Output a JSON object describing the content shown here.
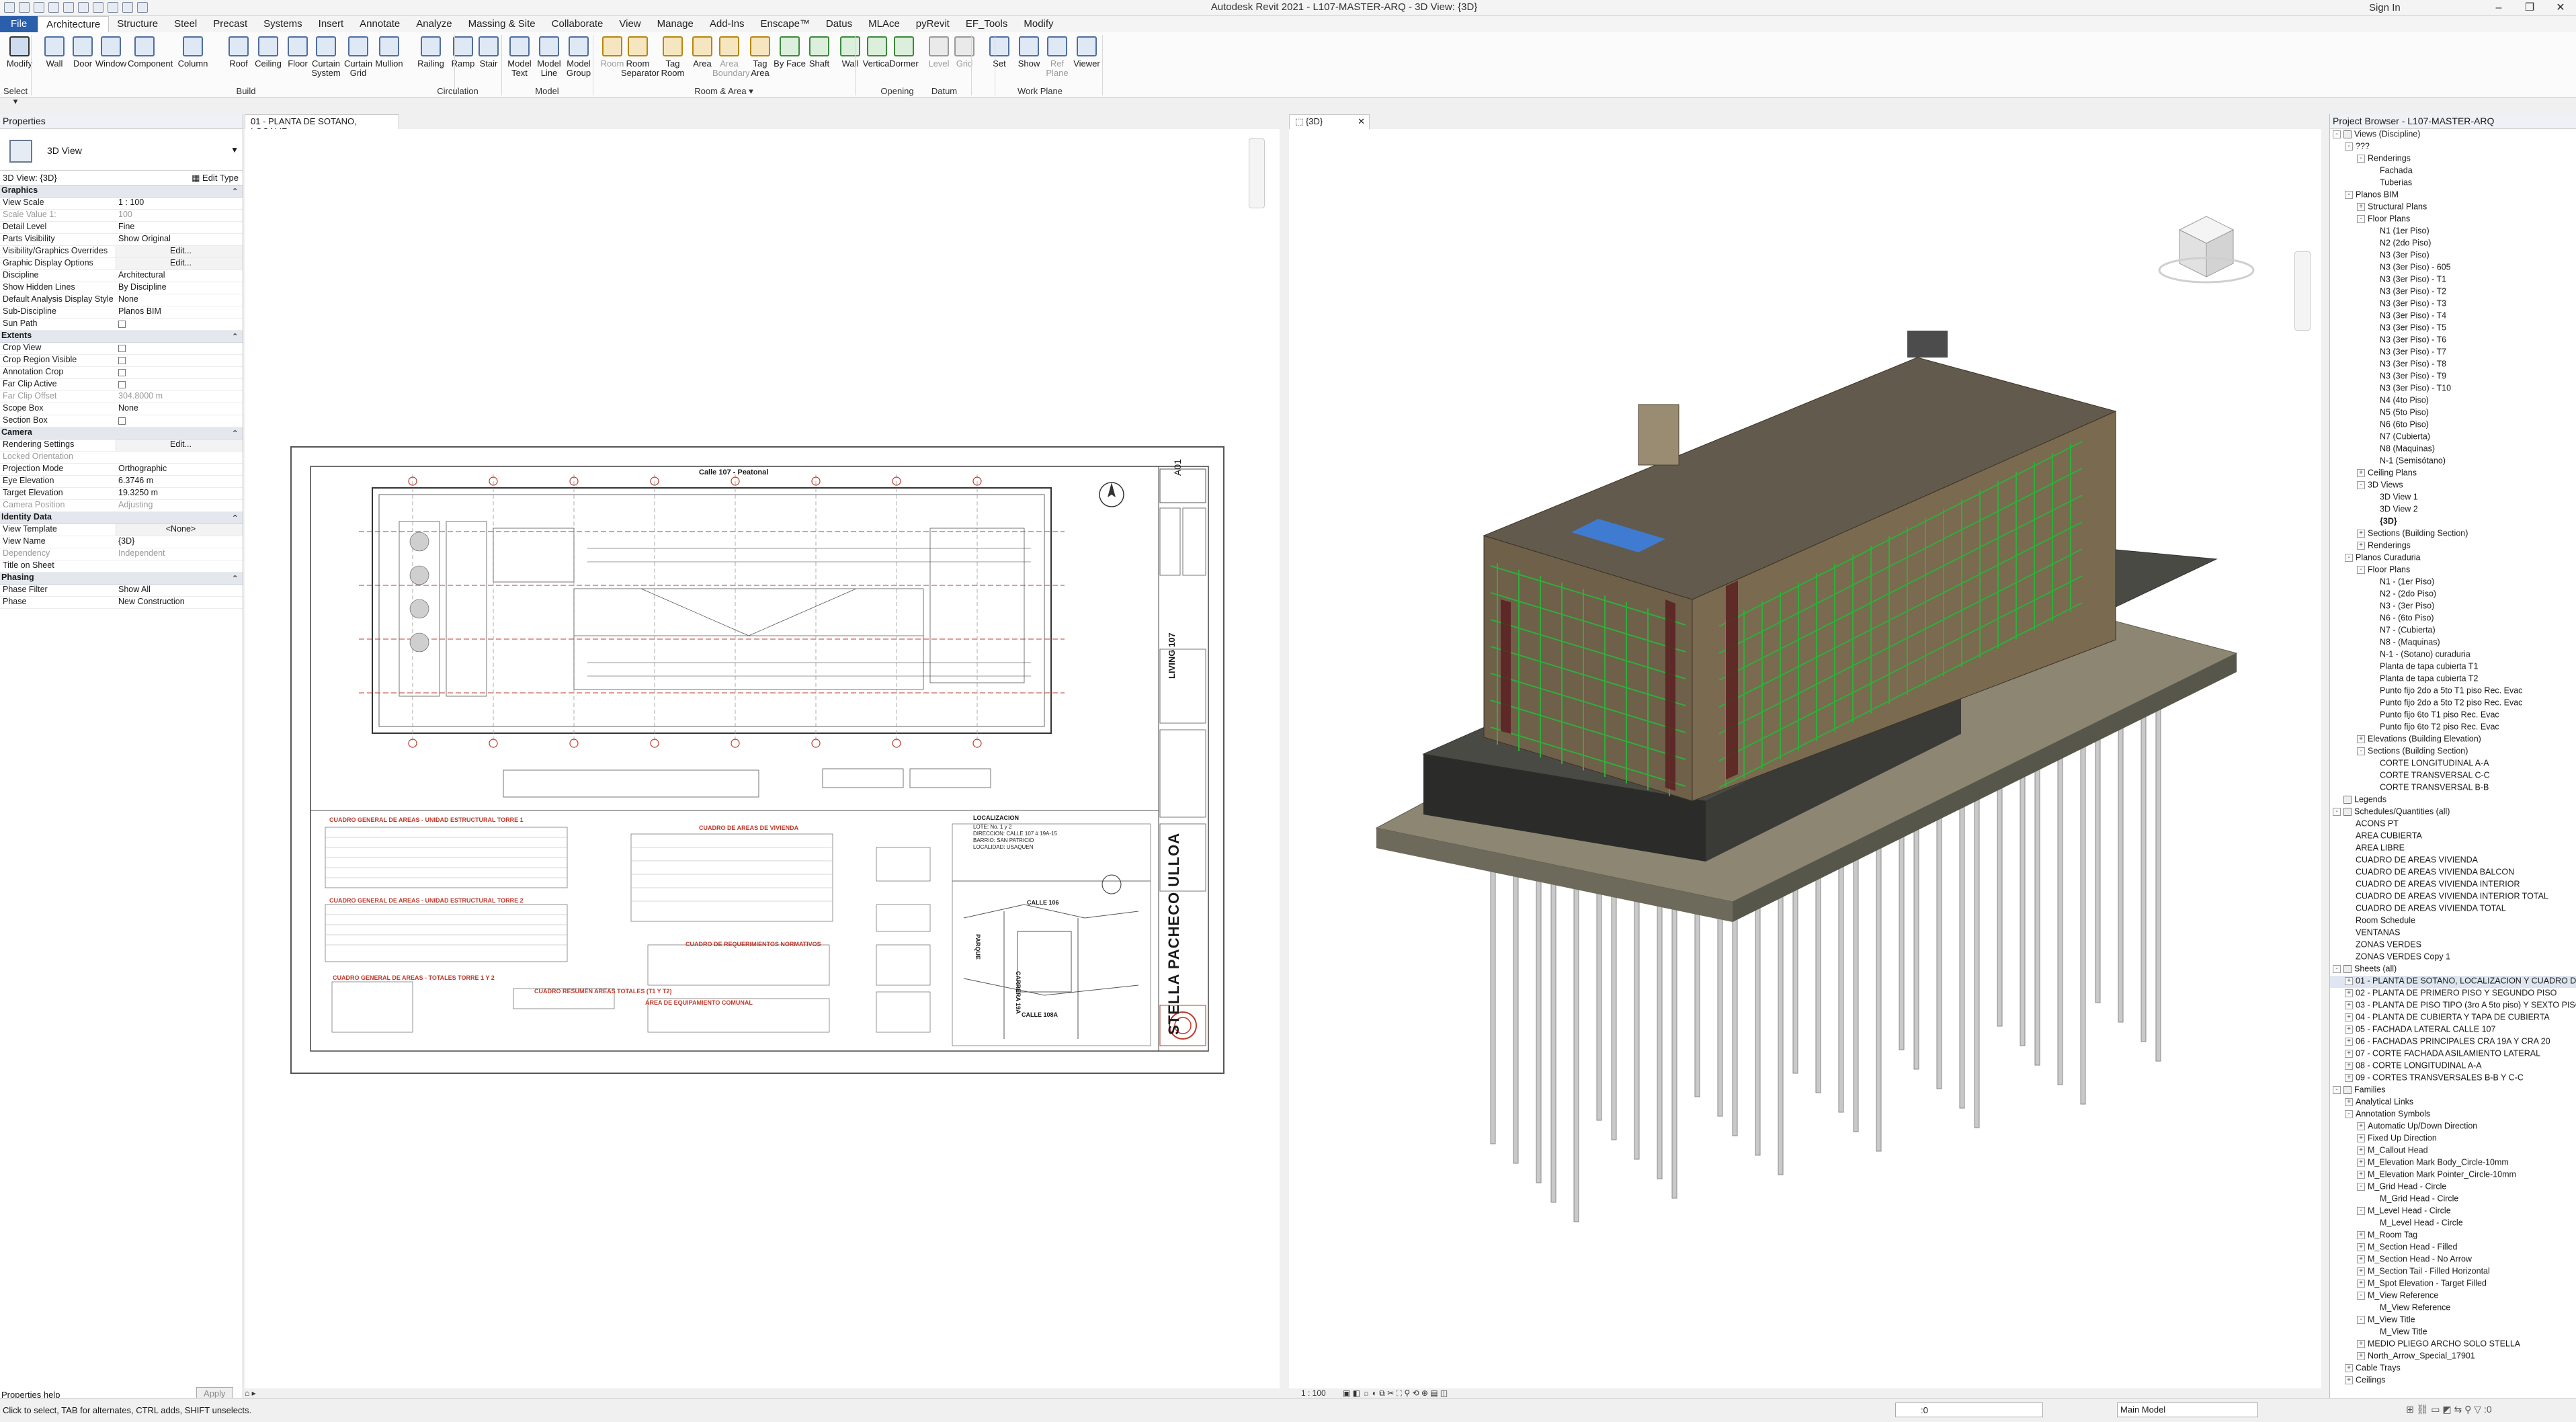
{
  "app": {
    "title": "Autodesk Revit 2021 - L107-MASTER-ARQ - 3D View: {3D}",
    "signin": "Sign In",
    "window_controls": [
      "–",
      "❐",
      "✕"
    ]
  },
  "ribbon": {
    "tabs": [
      "File",
      "Architecture",
      "Structure",
      "Steel",
      "Precast",
      "Systems",
      "Insert",
      "Annotate",
      "Analyze",
      "Massing & Site",
      "Collaborate",
      "View",
      "Manage",
      "Add-Ins",
      "Enscape™",
      "Datus",
      "MLAce",
      "pyRevit",
      "EF_Tools",
      "Modify"
    ],
    "active_tab": "Architecture",
    "buttons": [
      {
        "label": "Modify",
        "panel": "Select"
      },
      {
        "label": "Wall"
      },
      {
        "label": "Door"
      },
      {
        "label": "Window"
      },
      {
        "label": "Component"
      },
      {
        "label": "Column"
      },
      {
        "label": "Roof"
      },
      {
        "label": "Ceiling"
      },
      {
        "label": "Floor"
      },
      {
        "label": "Curtain System"
      },
      {
        "label": "Curtain Grid"
      },
      {
        "label": "Mullion"
      },
      {
        "label": "Railing"
      },
      {
        "label": "Ramp"
      },
      {
        "label": "Stair"
      },
      {
        "label": "Model Text"
      },
      {
        "label": "Model Line"
      },
      {
        "label": "Model Group"
      },
      {
        "label": "Room"
      },
      {
        "label": "Room Separator"
      },
      {
        "label": "Tag Room"
      },
      {
        "label": "Area"
      },
      {
        "label": "Area Boundary"
      },
      {
        "label": "Tag Area"
      },
      {
        "label": "By Face"
      },
      {
        "label": "Shaft"
      },
      {
        "label": "Wall"
      },
      {
        "label": "Vertical"
      },
      {
        "label": "Dormer"
      },
      {
        "label": "Level"
      },
      {
        "label": "Grid"
      },
      {
        "label": "Set"
      },
      {
        "label": "Show"
      },
      {
        "label": "Ref Plane"
      },
      {
        "label": "Viewer"
      }
    ],
    "panels": [
      "Select ▾",
      "Build",
      "Circulation",
      "Model",
      "Room & Area ▾",
      "Opening",
      "Datum",
      "Work Plane"
    ]
  },
  "properties": {
    "header": "Properties",
    "type_name": "3D View",
    "instance_selector": "3D View: {3D}",
    "edit_type": "Edit Type",
    "groups": [
      {
        "name": "Graphics",
        "rows": [
          {
            "k": "View Scale",
            "v": "1 : 100"
          },
          {
            "k": "Scale Value    1:",
            "v": "100",
            "dim": true
          },
          {
            "k": "Detail Level",
            "v": "Fine"
          },
          {
            "k": "Parts Visibility",
            "v": "Show Original"
          },
          {
            "k": "Visibility/Graphics Overrides",
            "v": "Edit...",
            "btn": true
          },
          {
            "k": "Graphic Display Options",
            "v": "Edit...",
            "btn": true
          },
          {
            "k": "Discipline",
            "v": "Architectural"
          },
          {
            "k": "Show Hidden Lines",
            "v": "By Discipline"
          },
          {
            "k": "Default Analysis Display Style",
            "v": "None"
          },
          {
            "k": "Sub-Discipline",
            "v": "Planos BIM"
          },
          {
            "k": "Sun Path",
            "v": "",
            "cb": true
          }
        ]
      },
      {
        "name": "Extents",
        "rows": [
          {
            "k": "Crop View",
            "v": "",
            "cb": true
          },
          {
            "k": "Crop Region Visible",
            "v": "",
            "cb": true
          },
          {
            "k": "Annotation Crop",
            "v": "",
            "cb": true
          },
          {
            "k": "Far Clip Active",
            "v": "",
            "cb": true
          },
          {
            "k": "Far Clip Offset",
            "v": "304.8000 m",
            "dim": true
          },
          {
            "k": "Scope Box",
            "v": "None"
          },
          {
            "k": "Section Box",
            "v": "",
            "cb": true
          }
        ]
      },
      {
        "name": "Camera",
        "rows": [
          {
            "k": "Rendering Settings",
            "v": "Edit...",
            "btn": true
          },
          {
            "k": "Locked Orientation",
            "v": "",
            "dim": true
          },
          {
            "k": "Projection Mode",
            "v": "Orthographic"
          },
          {
            "k": "Eye Elevation",
            "v": "6.3746 m"
          },
          {
            "k": "Target Elevation",
            "v": "19.3250 m"
          },
          {
            "k": "Camera Position",
            "v": "Adjusting",
            "dim": true
          }
        ]
      },
      {
        "name": "Identity Data",
        "rows": [
          {
            "k": "View Template",
            "v": "<None>",
            "btn": true
          },
          {
            "k": "View Name",
            "v": "{3D}"
          },
          {
            "k": "Dependency",
            "v": "Independent",
            "dim": true
          },
          {
            "k": "Title on Sheet",
            "v": ""
          }
        ]
      },
      {
        "name": "Phasing",
        "rows": [
          {
            "k": "Phase Filter",
            "v": "Show All"
          },
          {
            "k": "Phase",
            "v": "New Construction"
          }
        ]
      }
    ],
    "help_link": "Properties help",
    "apply": "Apply"
  },
  "views": {
    "sheet_tab": "01 - PLANTA DE SOTANO, LOCALIZ...",
    "tab_3d": "{3D}",
    "scale_3d": "1 : 100",
    "sheet": {
      "plan_title": "Calle 107 - Peatonal",
      "sheet_number": "A01",
      "architect": "STELLA PACHECO ULLOA",
      "project": "LIVING 107",
      "tables": [
        "CUADRO GENERAL DE AREAS - UNIDAD ESTRUCTURAL TORRE 1",
        "CUADRO DE AREAS DE VIVIENDA",
        "CUADRO GENERAL DE AREAS - UNIDAD ESTRUCTURAL TORRE 2",
        "CUADRO DE REQUERIMIENTOS NORMATIVOS",
        "CUADRO GENERAL DE AREAS - TOTALES TORRE 1 Y 2",
        "CUADRO RESUMEN AREAS TOTALES (T1 Y T2)",
        "AREA DE EQUIPAMIENTO COMUNAL"
      ],
      "localization_title": "LOCALIZACION",
      "localization_lines": [
        "LOTE: No. 1 y 2",
        "DIRECCION: CALLE 107 # 19A-15",
        "BARRIO: SAN PATRICIO",
        "LOCALIDAD: USAQUEN"
      ],
      "street_labels": [
        "CALLE 106",
        "CARRERA 19A",
        "CALLE 108A",
        "PARQUE"
      ]
    }
  },
  "browser": {
    "header": "Project Browser - L107-MASTER-ARQ",
    "items": [
      {
        "d": 0,
        "e": "-",
        "t": "Views (Discipline)",
        "icon": true
      },
      {
        "d": 1,
        "e": "-",
        "t": "???"
      },
      {
        "d": 2,
        "e": "-",
        "t": "Renderings"
      },
      {
        "d": 3,
        "e": "",
        "t": "Fachada"
      },
      {
        "d": 3,
        "e": "",
        "t": "Tuberias"
      },
      {
        "d": 1,
        "e": "-",
        "t": "Planos BIM"
      },
      {
        "d": 2,
        "e": "+",
        "t": "Structural Plans"
      },
      {
        "d": 2,
        "e": "-",
        "t": "Floor Plans"
      },
      {
        "d": 3,
        "e": "",
        "t": "N1 (1er Piso)"
      },
      {
        "d": 3,
        "e": "",
        "t": "N2 (2do Piso)"
      },
      {
        "d": 3,
        "e": "",
        "t": "N3 (3er Piso)"
      },
      {
        "d": 3,
        "e": "",
        "t": "N3 (3er Piso) - 605"
      },
      {
        "d": 3,
        "e": "",
        "t": "N3 (3er Piso) - T1"
      },
      {
        "d": 3,
        "e": "",
        "t": "N3 (3er Piso) - T2"
      },
      {
        "d": 3,
        "e": "",
        "t": "N3 (3er Piso) - T3"
      },
      {
        "d": 3,
        "e": "",
        "t": "N3 (3er Piso) - T4"
      },
      {
        "d": 3,
        "e": "",
        "t": "N3 (3er Piso) - T5"
      },
      {
        "d": 3,
        "e": "",
        "t": "N3 (3er Piso) - T6"
      },
      {
        "d": 3,
        "e": "",
        "t": "N3 (3er Piso) - T7"
      },
      {
        "d": 3,
        "e": "",
        "t": "N3 (3er Piso) - T8"
      },
      {
        "d": 3,
        "e": "",
        "t": "N3 (3er Piso) - T9"
      },
      {
        "d": 3,
        "e": "",
        "t": "N3 (3er Piso) - T10"
      },
      {
        "d": 3,
        "e": "",
        "t": "N4 (4to Piso)"
      },
      {
        "d": 3,
        "e": "",
        "t": "N5 (5to Piso)"
      },
      {
        "d": 3,
        "e": "",
        "t": "N6 (6to Piso)"
      },
      {
        "d": 3,
        "e": "",
        "t": "N7 (Cubierta)"
      },
      {
        "d": 3,
        "e": "",
        "t": "N8 (Maquinas)"
      },
      {
        "d": 3,
        "e": "",
        "t": "N-1 (Semisótano)"
      },
      {
        "d": 2,
        "e": "+",
        "t": "Ceiling Plans"
      },
      {
        "d": 2,
        "e": "-",
        "t": "3D Views"
      },
      {
        "d": 3,
        "e": "",
        "t": "3D View 1"
      },
      {
        "d": 3,
        "e": "",
        "t": "3D View 2"
      },
      {
        "d": 3,
        "e": "",
        "t": "{3D}",
        "bold": true
      },
      {
        "d": 2,
        "e": "+",
        "t": "Sections (Building Section)"
      },
      {
        "d": 2,
        "e": "+",
        "t": "Renderings"
      },
      {
        "d": 1,
        "e": "-",
        "t": "Planos Curaduria"
      },
      {
        "d": 2,
        "e": "-",
        "t": "Floor Plans"
      },
      {
        "d": 3,
        "e": "",
        "t": "N1 - (1er Piso)"
      },
      {
        "d": 3,
        "e": "",
        "t": "N2 - (2do Piso)"
      },
      {
        "d": 3,
        "e": "",
        "t": "N3 - (3er Piso)"
      },
      {
        "d": 3,
        "e": "",
        "t": "N6 - (6to Piso)"
      },
      {
        "d": 3,
        "e": "",
        "t": "N7 - (Cubierta)"
      },
      {
        "d": 3,
        "e": "",
        "t": "N8 - (Maquinas)"
      },
      {
        "d": 3,
        "e": "",
        "t": "N-1 - (Sotano) curaduria"
      },
      {
        "d": 3,
        "e": "",
        "t": "Planta de tapa cubierta T1"
      },
      {
        "d": 3,
        "e": "",
        "t": "Planta de tapa cubierta T2"
      },
      {
        "d": 3,
        "e": "",
        "t": "Punto fijo 2do a 5to T1 piso Rec. Evac"
      },
      {
        "d": 3,
        "e": "",
        "t": "Punto fijo 2do a 5to T2 piso Rec. Evac"
      },
      {
        "d": 3,
        "e": "",
        "t": "Punto fijo 6to T1 piso Rec. Evac"
      },
      {
        "d": 3,
        "e": "",
        "t": "Punto fijo 6to T2 piso Rec. Evac"
      },
      {
        "d": 2,
        "e": "+",
        "t": "Elevations (Building Elevation)"
      },
      {
        "d": 2,
        "e": "-",
        "t": "Sections (Building Section)"
      },
      {
        "d": 3,
        "e": "",
        "t": "CORTE LONGITUDINAL A-A"
      },
      {
        "d": 3,
        "e": "",
        "t": "CORTE TRANSVERSAL C-C"
      },
      {
        "d": 3,
        "e": "",
        "t": "CORTE TRANSVERSAL B-B"
      },
      {
        "d": 0,
        "e": "",
        "t": "Legends",
        "icon": true
      },
      {
        "d": 0,
        "e": "-",
        "t": "Schedules/Quantities (all)",
        "icon": true
      },
      {
        "d": 1,
        "e": "",
        "t": "ACONS PT"
      },
      {
        "d": 1,
        "e": "",
        "t": "AREA CUBIERTA"
      },
      {
        "d": 1,
        "e": "",
        "t": "AREA LIBRE"
      },
      {
        "d": 1,
        "e": "",
        "t": "CUADRO DE AREAS VIVIENDA"
      },
      {
        "d": 1,
        "e": "",
        "t": "CUADRO DE AREAS VIVIENDA BALCON"
      },
      {
        "d": 1,
        "e": "",
        "t": "CUADRO DE AREAS VIVIENDA INTERIOR"
      },
      {
        "d": 1,
        "e": "",
        "t": "CUADRO DE AREAS VIVIENDA INTERIOR TOTAL"
      },
      {
        "d": 1,
        "e": "",
        "t": "CUADRO DE AREAS VIVIENDA TOTAL"
      },
      {
        "d": 1,
        "e": "",
        "t": "Room Schedule"
      },
      {
        "d": 1,
        "e": "",
        "t": "VENTANAS"
      },
      {
        "d": 1,
        "e": "",
        "t": "ZONAS VERDES"
      },
      {
        "d": 1,
        "e": "",
        "t": "ZONAS VERDES Copy 1"
      },
      {
        "d": 0,
        "e": "-",
        "t": "Sheets (all)",
        "icon": true
      },
      {
        "d": 1,
        "e": "+",
        "t": "01 - PLANTA DE SOTANO, LOCALIZACION Y CUADRO DE A",
        "sel": true
      },
      {
        "d": 1,
        "e": "+",
        "t": "02 - PLANTA DE PRIMERO PISO Y SEGUNDO PISO"
      },
      {
        "d": 1,
        "e": "+",
        "t": "03 - PLANTA DE PISO TIPO (3ro A 5to piso) Y SEXTO PISO"
      },
      {
        "d": 1,
        "e": "+",
        "t": "04 - PLANTA DE CUBIERTA Y TAPA DE CUBIERTA"
      },
      {
        "d": 1,
        "e": "+",
        "t": "05 - FACHADA LATERAL CALLE 107"
      },
      {
        "d": 1,
        "e": "+",
        "t": "06 - FACHADAS PRINCIPALES CRA 19A Y CRA 20"
      },
      {
        "d": 1,
        "e": "+",
        "t": "07 - CORTE FACHADA ASILAMIENTO LATERAL"
      },
      {
        "d": 1,
        "e": "+",
        "t": "08 - CORTE LONGITUDINAL A-A"
      },
      {
        "d": 1,
        "e": "+",
        "t": "09 - CORTES TRANSVERSALES B-B Y C-C"
      },
      {
        "d": 0,
        "e": "-",
        "t": "Families",
        "icon": true
      },
      {
        "d": 1,
        "e": "+",
        "t": "Analytical Links"
      },
      {
        "d": 1,
        "e": "-",
        "t": "Annotation Symbols"
      },
      {
        "d": 2,
        "e": "+",
        "t": "Automatic Up/Down Direction"
      },
      {
        "d": 2,
        "e": "+",
        "t": "Fixed Up Direction"
      },
      {
        "d": 2,
        "e": "+",
        "t": "M_Callout Head"
      },
      {
        "d": 2,
        "e": "+",
        "t": "M_Elevation Mark Body_Circle-10mm"
      },
      {
        "d": 2,
        "e": "+",
        "t": "M_Elevation Mark Pointer_Circle-10mm"
      },
      {
        "d": 2,
        "e": "-",
        "t": "M_Grid Head - Circle"
      },
      {
        "d": 3,
        "e": "",
        "t": "M_Grid Head - Circle"
      },
      {
        "d": 2,
        "e": "-",
        "t": "M_Level Head - Circle"
      },
      {
        "d": 3,
        "e": "",
        "t": "M_Level Head - Circle"
      },
      {
        "d": 2,
        "e": "+",
        "t": "M_Room Tag"
      },
      {
        "d": 2,
        "e": "+",
        "t": "M_Section Head - Filled"
      },
      {
        "d": 2,
        "e": "+",
        "t": "M_Section Head - No Arrow"
      },
      {
        "d": 2,
        "e": "+",
        "t": "M_Section Tail - Filled Horizontal"
      },
      {
        "d": 2,
        "e": "+",
        "t": "M_Spot Elevation - Target Filled"
      },
      {
        "d": 2,
        "e": "-",
        "t": "M_View Reference"
      },
      {
        "d": 3,
        "e": "",
        "t": "M_View Reference"
      },
      {
        "d": 2,
        "e": "-",
        "t": "M_View Title"
      },
      {
        "d": 3,
        "e": "",
        "t": "M_View Title"
      },
      {
        "d": 2,
        "e": "+",
        "t": "MEDIO PLIEGO ARCHO SOLO STELLA"
      },
      {
        "d": 2,
        "e": "+",
        "t": "North_Arrow_Special_17901"
      },
      {
        "d": 1,
        "e": "+",
        "t": "Cable Trays"
      },
      {
        "d": 1,
        "e": "+",
        "t": "Ceilings"
      }
    ]
  },
  "statusbar": {
    "message": "Click to select, TAB for alternates, CTRL adds, SHIFT unselects.",
    "model": "Main Model",
    "zero": ":0"
  }
}
